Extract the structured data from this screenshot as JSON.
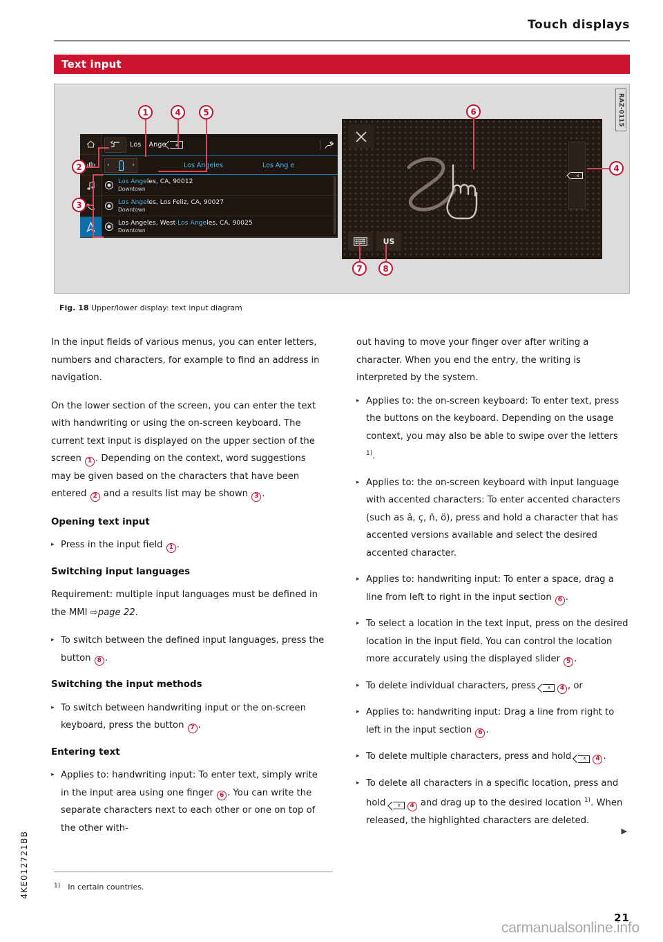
{
  "header": {
    "title": "Touch displays"
  },
  "section": {
    "banner_label": "Text input"
  },
  "figure": {
    "raz_code": "RAZ-0115",
    "caption_prefix": "Fig. 18",
    "caption_text": "Upper/lower display: text input diagram",
    "callouts": [
      "1",
      "2",
      "3",
      "4",
      "5",
      "6",
      "7",
      "8"
    ],
    "upper_display": {
      "sidebar_icons": [
        "home-icon",
        "media-icon",
        "music-note-icon",
        "phone-icon",
        "navigation-icon"
      ],
      "back_icon": "back-arrow-icon",
      "input_value": "Los|Ange",
      "input_text_before_caret": "Los",
      "input_text_after_caret": "Ange",
      "backspace_glyph": "x",
      "voice_icon": "voice-input-icon",
      "slider_prev": "‹",
      "slider_next": "›",
      "suggestions": [
        "Los Angeles",
        "Los Ang e"
      ],
      "results": [
        {
          "title_hl": "Los Ange",
          "title_rest": "les, CA, 90012",
          "subtitle": "Downtown"
        },
        {
          "title_hl": "Los Ange",
          "title_rest": "les, Los Feliz, CA, 90027",
          "subtitle": "Downtown"
        },
        {
          "title_pre": "Los Angeles, West ",
          "title_hl": "Los Ange",
          "title_rest": "les, CA, 90025",
          "subtitle": "Downtown"
        }
      ]
    },
    "lower_display": {
      "close_icon": "close-icon",
      "handwriting_icon": "handwriting-hand-icon",
      "delete_glyph": "x",
      "keyboard_button_icon": "keyboard-icon",
      "language_button_label": "US"
    }
  },
  "body": {
    "left": {
      "p1": "In the input fields of various menus, you can enter letters, numbers and characters, for example to find an address in navigation.",
      "p2_a": "On the lower section of the screen, you can enter the text with handwriting or using the on-screen keyboard. The current text input is displayed on the upper section of the screen ",
      "p2_b": ". Depending on the context, word suggestions may be given based on the characters that have been entered ",
      "p2_c": " and a results list may be shown ",
      "p2_d": ".",
      "h1": "Opening text input",
      "b1_a": "Press in the input field ",
      "b1_b": ".",
      "h2": "Switching input languages",
      "p3_a": "Requirement: multiple input languages must be defined in the MMI ",
      "p3_arrow": "⇨",
      "p3_link": "page 22",
      "p3_b": ".",
      "b2_a": "To switch between the defined input languages, press the button ",
      "b2_b": ".",
      "h3": "Switching the input methods",
      "b3_a": "To switch between handwriting input or the on-screen keyboard, press the button ",
      "b3_b": ".",
      "h4": "Entering text",
      "b4_a": "Applies to: handwriting input: To enter text, simply write in the input area using one finger ",
      "b4_b": ". You can write the separate characters next to each other or one on top of the other with-"
    },
    "right": {
      "p1": "out having to move your finger over after writing a character. When you end the entry, the writing is interpreted by the system.",
      "b1_a": "Applies to: the on-screen keyboard: To enter text, press the buttons on the keyboard. Depending on the usage context, you may also be able to swipe over the letters ",
      "b1_sup": "1)",
      "b1_b": ".",
      "b2": "Applies to: the on-screen keyboard with input language with accented characters: To enter accented characters (such as â, ç, ñ, ö), press and hold a character that has accented versions available and select the desired accented character.",
      "b3_a": "Applies to: handwriting input: To enter a space, drag a line from left to right in the input section ",
      "b3_b": ".",
      "b4_a": "To select a location in the text input, press on the desired location in the input field. You can control the location more accurately using the displayed slider ",
      "b4_b": ".",
      "b5_a": "To delete individual characters, press ",
      "b5_b": ", or",
      "b6_a": "Applies to: handwriting input: Drag a line from right to left in the input section ",
      "b6_b": ".",
      "b7_a": "To delete multiple characters, press and hold ",
      "b7_b": ".",
      "b8_a": "To delete all characters in a specific location, press and hold ",
      "b8_b": " and drag up to the desired location ",
      "b8_sup": "1)",
      "b8_c": ". When released, the highlighted characters are deleted.",
      "continue_arrow": "▶"
    }
  },
  "footer": {
    "footnote_marker": "1)",
    "footnote_text": "In certain countries.",
    "doc_code": "4KE012721BB",
    "page_number": "21",
    "watermark": "carmanualsonline.info"
  }
}
